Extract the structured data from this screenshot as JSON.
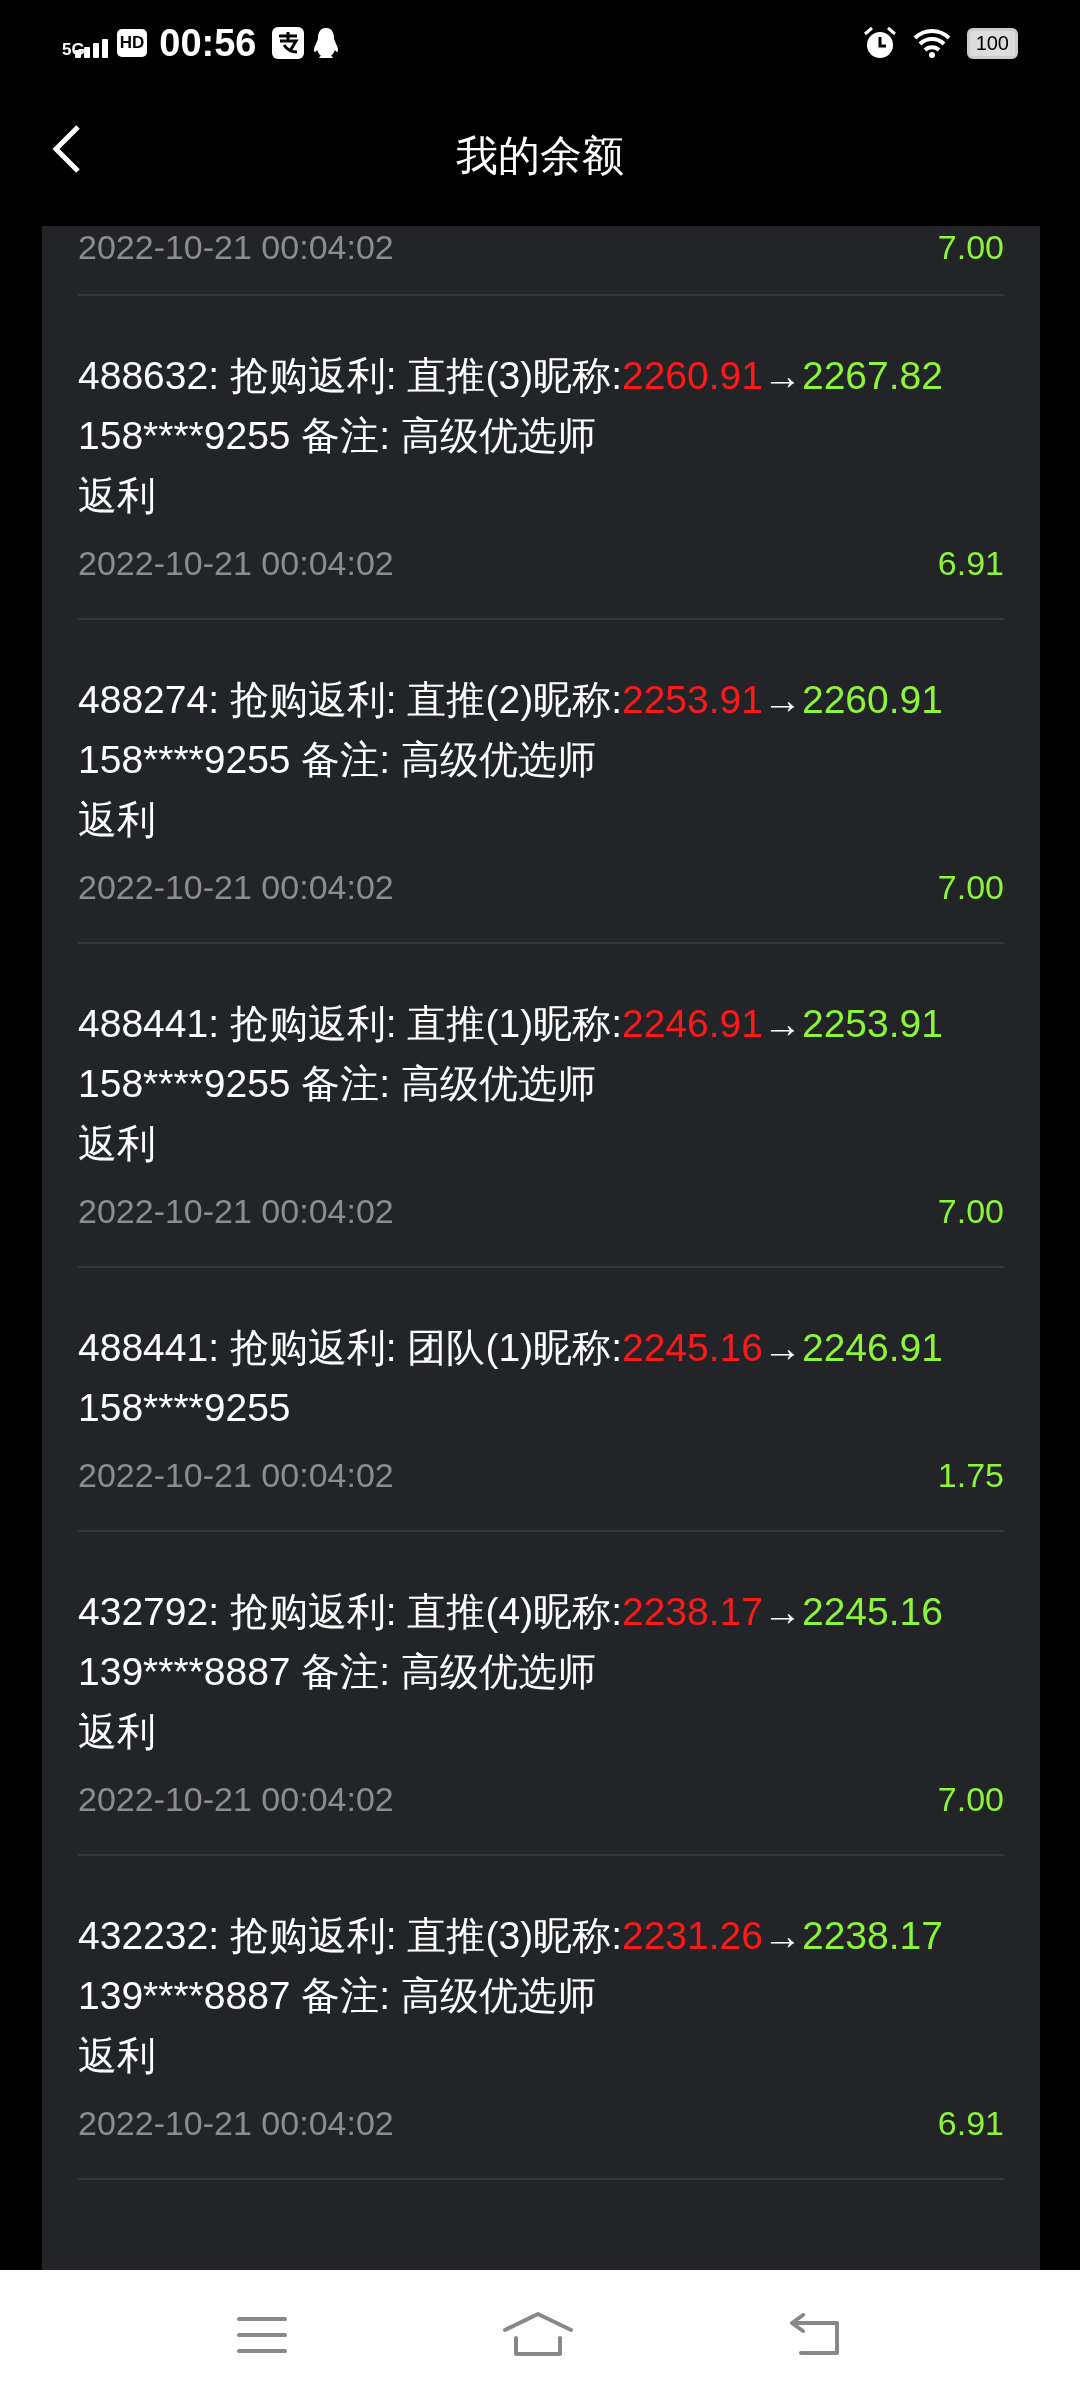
{
  "status_bar": {
    "network": "5G",
    "hd": "HD",
    "time": "00:56",
    "battery": "100"
  },
  "header": {
    "title": "我的余额"
  },
  "partial_record": {
    "date": "2022-10-21 00:04:02",
    "amount": "7.00"
  },
  "records": [
    {
      "prefix": "488632: 抢购返利: 直推(3)昵称:",
      "before": "2260.91",
      "arrow": "→",
      "after": "2267.82",
      "lines": [
        "158****9255 备注: 高级优选师",
        "返利"
      ],
      "date": "2022-10-21 00:04:02",
      "amount": "6.91"
    },
    {
      "prefix": "488274: 抢购返利: 直推(2)昵称:",
      "before": "2253.91",
      "arrow": "→",
      "after": "2260.91",
      "lines": [
        "158****9255 备注: 高级优选师",
        "返利"
      ],
      "date": "2022-10-21 00:04:02",
      "amount": "7.00"
    },
    {
      "prefix": "488441: 抢购返利: 直推(1)昵称:",
      "before": "2246.91",
      "arrow": "→",
      "after": "2253.91",
      "lines": [
        "158****9255 备注: 高级优选师",
        "返利"
      ],
      "date": "2022-10-21 00:04:02",
      "amount": "7.00"
    },
    {
      "prefix": "488441: 抢购返利: 团队(1)昵称:",
      "before": "2245.16",
      "arrow": "→",
      "after": "2246.91",
      "lines": [
        "158****9255"
      ],
      "date": "2022-10-21 00:04:02",
      "amount": "1.75"
    },
    {
      "prefix": "432792: 抢购返利: 直推(4)昵称:",
      "before": "2238.17",
      "arrow": "→",
      "after": "2245.16",
      "lines": [
        "139****8887 备注: 高级优选师",
        "返利"
      ],
      "date": "2022-10-21 00:04:02",
      "amount": "7.00"
    },
    {
      "prefix": "432232: 抢购返利: 直推(3)昵称:",
      "before": "2231.26",
      "arrow": "→",
      "after": "2238.17",
      "lines": [
        "139****8887 备注: 高级优选师",
        "返利"
      ],
      "date": "2022-10-21 00:04:02",
      "amount": "6.91"
    }
  ]
}
